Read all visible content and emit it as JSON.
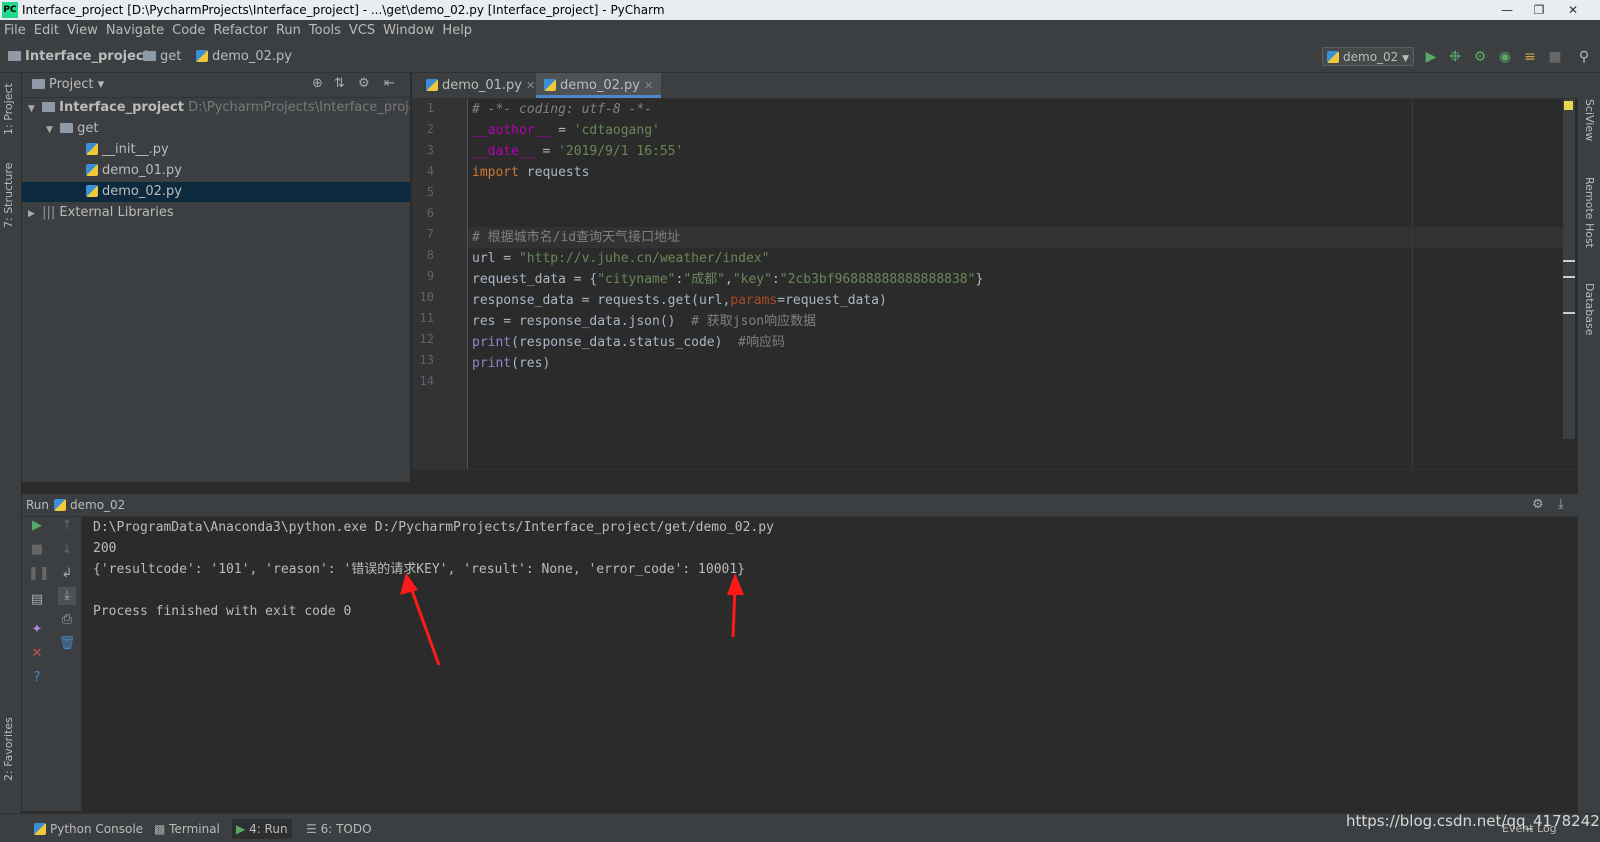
{
  "window": {
    "title": "Interface_project [D:\\PycharmProjects\\Interface_project] - ...\\get\\demo_02.py [Interface_project] - PyCharm",
    "app_badge": "PC"
  },
  "menu": [
    "File",
    "Edit",
    "View",
    "Navigate",
    "Code",
    "Refactor",
    "Run",
    "Tools",
    "VCS",
    "Window",
    "Help"
  ],
  "breadcrumb": [
    "Interface_project",
    "get",
    "demo_02.py"
  ],
  "run_config": "demo_02",
  "left_stripe": {
    "project": "1: Project",
    "structure": "7: Structure",
    "favorites": "2: Favorites"
  },
  "right_stripe": {
    "sciview": "SciView",
    "remote_host": "Remote Host",
    "database": "Database"
  },
  "project_panel": {
    "title": "Project",
    "tree": [
      {
        "label": "Interface_project",
        "path": "D:\\PycharmProjects\\Interface_project"
      },
      {
        "label": "get"
      },
      {
        "label": "__init__.py"
      },
      {
        "label": "demo_01.py"
      },
      {
        "label": "demo_02.py"
      },
      {
        "label": "External Libraries"
      }
    ]
  },
  "editor": {
    "tabs": [
      "demo_01.py",
      "demo_02.py"
    ],
    "active_tab": "demo_02.py",
    "line_numbers": [
      "1",
      "2",
      "3",
      "4",
      "5",
      "6",
      "7",
      "8",
      "9",
      "10",
      "11",
      "12",
      "13",
      "14"
    ],
    "code": {
      "l1": "# -*- coding: utf-8 -*-",
      "l2a": "__author__",
      "l2b": " = ",
      "l2c": "'cdtaogang'",
      "l3a": "__date__",
      "l3b": " = ",
      "l3c": "'2019/9/1 16:55'",
      "l4a": "import",
      "l4b": " requests",
      "l7": "# 根据城市名/id查询天气接口地址",
      "l8a": "url = ",
      "l8b": "\"http://v.juhe.cn/weather/index\"",
      "l9a": "request_data = {",
      "l9b": "\"cityname\"",
      "l9c": ":",
      "l9d": "\"成都\"",
      "l9e": ",",
      "l9f": "\"key\"",
      "l9g": ":",
      "l9h": "\"2cb3bf96888888888888838\"",
      "l9i": "}",
      "l10a": "response_data = requests.get(url,",
      "l10b": "params",
      "l10c": "=request_data)",
      "l11a": "res = response_data.json()  ",
      "l11b": "# 获取json响应数据",
      "l12a": "print",
      "l12b": "(response_data.status_code)  ",
      "l12c": "#响应码",
      "l13a": "print",
      "l13b": "(res)"
    }
  },
  "run_panel": {
    "label": "Run",
    "config": "demo_02",
    "output": [
      "D:\\ProgramData\\Anaconda3\\python.exe D:/PycharmProjects/Interface_project/get/demo_02.py",
      "200",
      "{'resultcode': '101', 'reason': '错误的请求KEY', 'result': None, 'error_code': 10001}",
      "",
      "Process finished with exit code 0"
    ]
  },
  "bottom_bar": {
    "python_console": "Python Console",
    "terminal": "Terminal",
    "run": "4: Run",
    "todo": "6: TODO",
    "event_log": "Event Log"
  },
  "watermark": "https://blog.csdn.net/qq_41782425",
  "colors": {
    "arrow": "#ff1a1a",
    "accent": "#4a88c7",
    "selection": "#0d293e"
  }
}
